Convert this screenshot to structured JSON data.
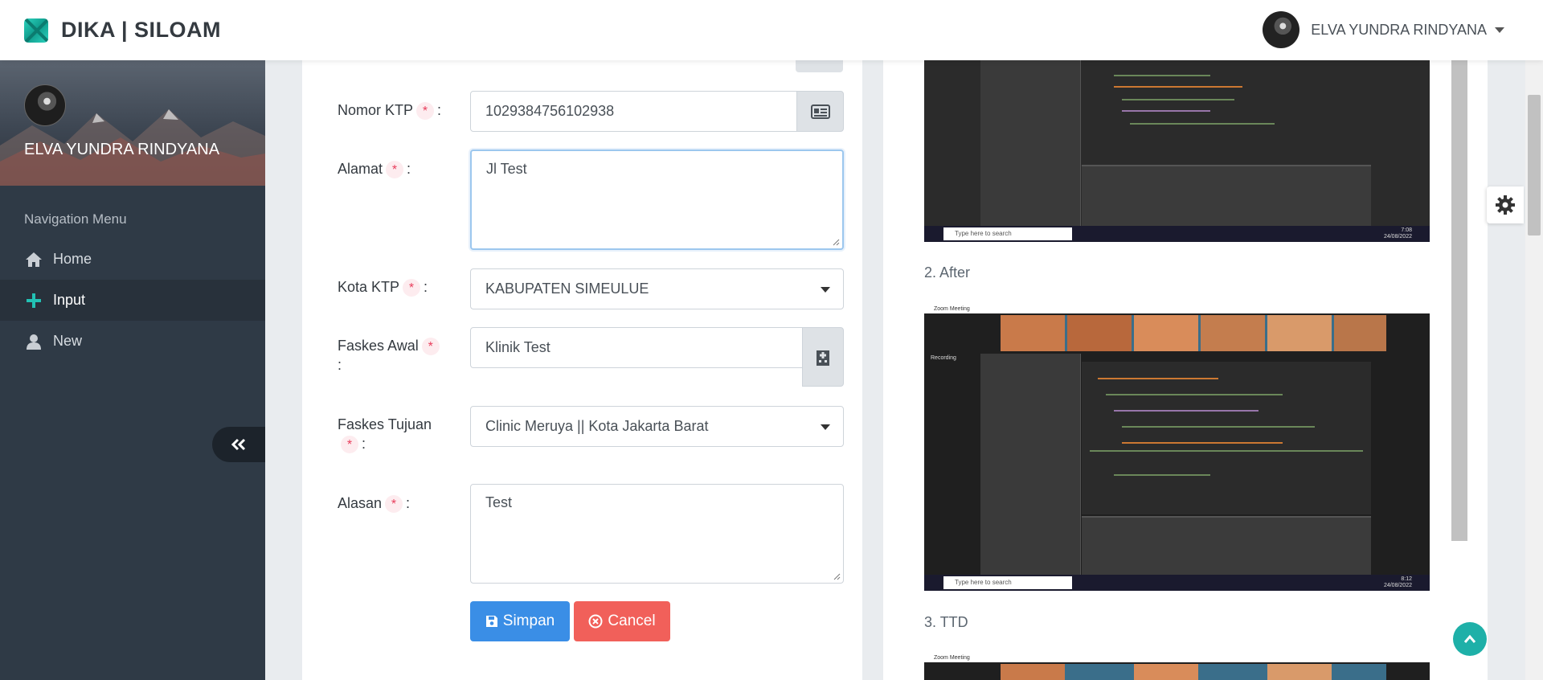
{
  "brand": {
    "name": "DIKA | SILOAM",
    "accent": "#1eb0a8"
  },
  "header": {
    "user_name": "ELVA YUNDRA RINDYANA"
  },
  "sidebar": {
    "profile_name": "ELVA YUNDRA RINDYANA",
    "nav_header": "Navigation Menu",
    "items": [
      {
        "label": "Home",
        "icon": "home-icon"
      },
      {
        "label": "Input",
        "icon": "plus-icon",
        "active": true
      },
      {
        "label": "New",
        "icon": "user-icon"
      }
    ],
    "bg": "#2f3a46"
  },
  "form": {
    "nomor_ktp": {
      "label": "Nomor KTP",
      "value": "1029384756102938"
    },
    "alamat": {
      "label": "Alamat",
      "value": "Jl Test"
    },
    "kota_ktp": {
      "label": "Kota KTP",
      "value": "KABUPATEN SIMEULUE"
    },
    "faskes_awal": {
      "label": "Faskes Awal",
      "value": "Klinik Test"
    },
    "faskes_tujuan": {
      "label": "Faskes Tujuan",
      "value": "Clinic Meruya || Kota Jakarta Barat"
    },
    "alasan": {
      "label": "Alasan",
      "value": "Test"
    },
    "required_mark": "*",
    "colon": ":",
    "save_label": "Simpan",
    "cancel_label": "Cancel",
    "save_color": "#3a8ee6",
    "cancel_color": "#f1605a"
  },
  "attachments": {
    "after_heading": "2. After",
    "ttd_heading": "3. TTD",
    "taskbar_search": "Type here to search",
    "taskbar_time_1": "7:08",
    "taskbar_date_1": "24/08/2022",
    "taskbar_time_2": "8:12",
    "taskbar_date_2": "24/08/2022",
    "zoom_title": "Zoom Meeting",
    "recording": "Recording"
  }
}
